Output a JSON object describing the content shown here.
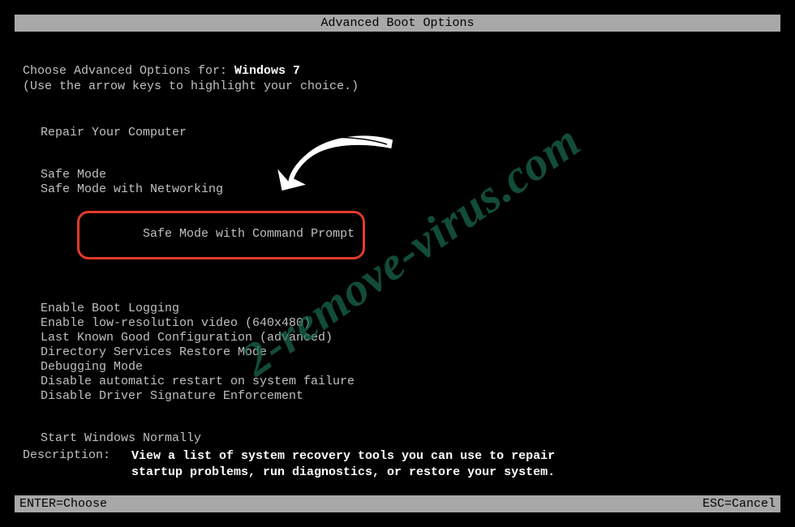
{
  "title": "Advanced Boot Options",
  "prompt_prefix": "Choose Advanced Options for: ",
  "os_name": "Windows 7",
  "hint": "(Use the arrow keys to highlight your choice.)",
  "menu": {
    "repair": "Repair Your Computer",
    "safe_mode": "Safe Mode",
    "safe_mode_net": "Safe Mode with Networking",
    "safe_mode_cmd": "Safe Mode with Command Prompt",
    "boot_log": "Enable Boot Logging",
    "low_res": "Enable low-resolution video (640x480)",
    "lkgc": "Last Known Good Configuration (advanced)",
    "dsrm": "Directory Services Restore Mode",
    "debug": "Debugging Mode",
    "no_auto_restart": "Disable automatic restart on system failure",
    "no_drv_sig": "Disable Driver Signature Enforcement",
    "start_normal": "Start Windows Normally"
  },
  "description_label": "Description:",
  "description_text": "View a list of system recovery tools you can use to repair startup problems, run diagnostics, or restore your system.",
  "footer": {
    "left": "ENTER=Choose",
    "right": "ESC=Cancel"
  },
  "watermark": "2-remove-virus.com",
  "annotation": {
    "highlighted_item": "safe_mode_cmd",
    "arrow_target": "safe_mode_cmd",
    "highlight_color": "#e33a2a"
  }
}
